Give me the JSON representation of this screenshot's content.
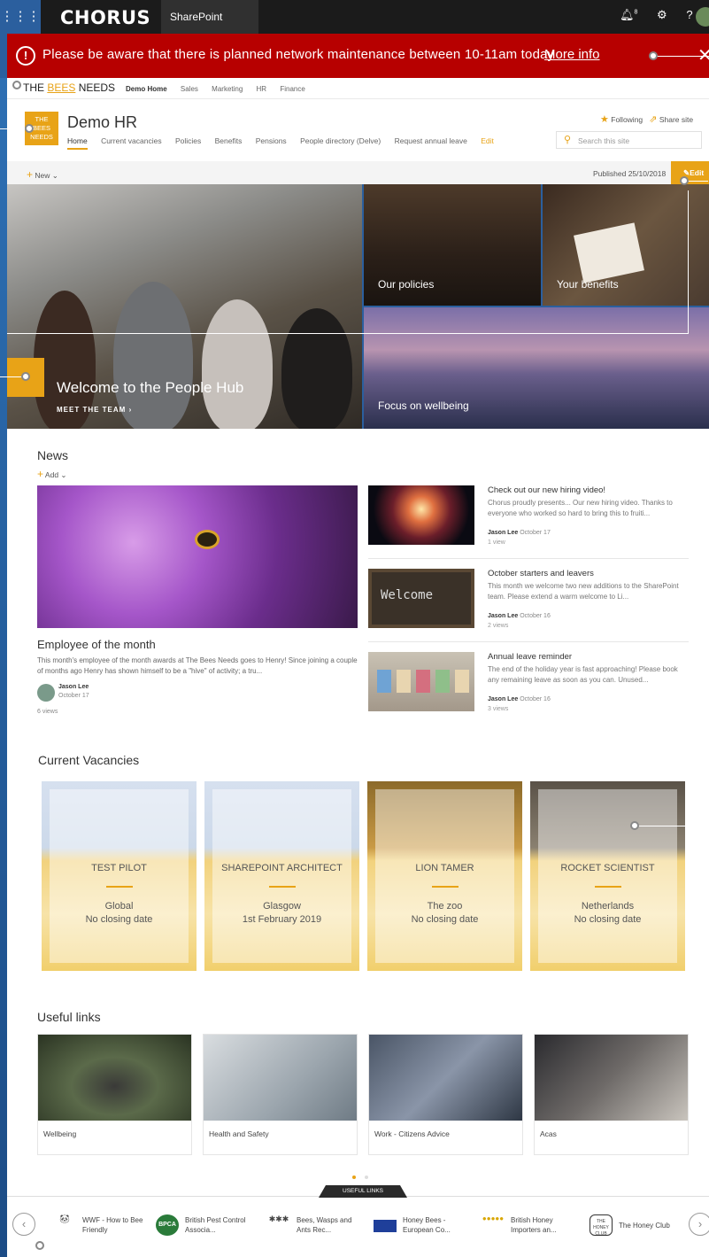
{
  "suite": {
    "brand": "CHORUS",
    "app": "SharePoint",
    "notification_count": "8"
  },
  "alert": {
    "message": "Please be aware that there is planned network maintenance between 10-11am today",
    "link": "More info"
  },
  "hub_nav": {
    "logo_pre": "THE ",
    "logo_mid": "BEES",
    "logo_post": " NEEDS",
    "items": [
      "Demo Home",
      "Sales",
      "Marketing",
      "HR",
      "Finance"
    ]
  },
  "site": {
    "logo_text": [
      "THE",
      "BEES",
      "NEEDS"
    ],
    "title": "Demo HR",
    "nav": [
      "Home",
      "Current vacancies",
      "Policies",
      "Benefits",
      "Pensions",
      "People directory (Delve)",
      "Request annual leave",
      "Edit"
    ],
    "following": "Following",
    "share": "Share site",
    "search_placeholder": "Search this site"
  },
  "command_bar": {
    "new": "New",
    "published": "Published 25/10/2018",
    "edit": "Edit"
  },
  "hero": {
    "main_title": "Welcome to the People Hub",
    "main_sub": "MEET THE TEAM",
    "tiles": [
      "Our policies",
      "Your benefits",
      "Focus on wellbeing"
    ]
  },
  "news": {
    "title": "News",
    "add": "Add",
    "main": {
      "title": "Employee of the month",
      "desc": "This month's employee of the month awards at The Bees Needs goes to Henry! Since joining a couple of months ago Henry has shown himself to be a \"hive\" of activity; a tru...",
      "author": "Jason Lee",
      "date": "October 17",
      "views": "6 views"
    },
    "items": [
      {
        "title": "Check out our new hiring video!",
        "desc": "Chorus proudly presents... Our new hiring video. Thanks to everyone who worked so hard to bring this to fruiti...",
        "author": "Jason Lee",
        "date": "October 17",
        "views": "1 view"
      },
      {
        "title": "October starters and leavers",
        "desc": "This month we welcome two new additions to the SharePoint team. Please extend a warm welcome to Li...",
        "author": "Jason Lee",
        "date": "October 16",
        "views": "2 views",
        "thumb_text": "Welcome"
      },
      {
        "title": "Annual leave reminder",
        "desc": "The end of the holiday year is fast approaching! Please book any remaining leave as soon as you can. Unused...",
        "author": "Jason Lee",
        "date": "October 16",
        "views": "3 views"
      }
    ]
  },
  "vacancies": {
    "title": "Current Vacancies",
    "items": [
      {
        "role": "TEST PILOT",
        "location": "Global",
        "closing": "No closing date"
      },
      {
        "role": "SHAREPOINT ARCHITECT",
        "location": "Glasgow",
        "closing": "1st February 2019"
      },
      {
        "role": "LION TAMER",
        "location": "The zoo",
        "closing": "No closing date"
      },
      {
        "role": "ROCKET SCIENTIST",
        "location": "Netherlands",
        "closing": "No closing date"
      }
    ]
  },
  "useful_links": {
    "title": "Useful links",
    "items": [
      "Wellbeing",
      "Health and Safety",
      "Work - Citizens Advice",
      "Acas"
    ]
  },
  "footer": {
    "tab": "USEFUL LINKS",
    "links": [
      {
        "label": "WWF - How to Bee Friendly",
        "logo": "panda"
      },
      {
        "label": "British Pest Control Associa...",
        "logo": "BPCA"
      },
      {
        "label": "Bees, Wasps and Ants Rec...",
        "logo": "insects"
      },
      {
        "label": "Honey Bees - European Co...",
        "logo": "eu-flag"
      },
      {
        "label": "British Honey Importers an...",
        "logo": "honey"
      },
      {
        "label": "The Honey Club",
        "logo": "THE HONEY CLUB"
      }
    ]
  },
  "colors": {
    "accent": "#e8a317",
    "alert": "#b70000",
    "suite_bar": "#1b1b1b"
  }
}
